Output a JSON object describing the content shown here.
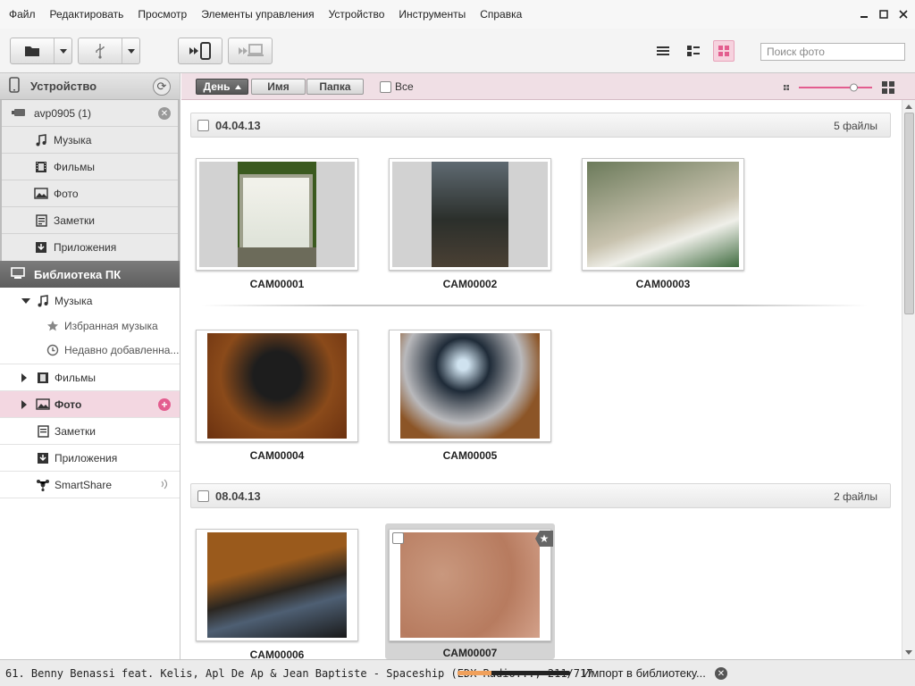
{
  "menu": [
    "Файл",
    "Редактировать",
    "Просмотр",
    "Элементы управления",
    "Устройство",
    "Инструменты",
    "Справка"
  ],
  "window_controls": [
    "minimize-icon",
    "maximize-icon",
    "close-icon"
  ],
  "search": {
    "placeholder": "Поиск фото"
  },
  "sidebar": {
    "device_header": "Устройство",
    "device_name": "avp0905 (1)",
    "device_items": [
      "Музыка",
      "Фильмы",
      "Фото",
      "Заметки",
      "Приложения"
    ],
    "library_header": "Библиотека ПК",
    "library": {
      "music": "Музыка",
      "music_children": [
        "Избранная музыка",
        "Недавно добавленна..."
      ],
      "films": "Фильмы",
      "photo": "Фото",
      "notes": "Заметки",
      "apps": "Приложения",
      "smartshare": "SmartShare"
    }
  },
  "sortbar": {
    "day": "День",
    "name": "Имя",
    "folder": "Папка",
    "all": "Все",
    "zoom_level": 0.75
  },
  "groups": [
    {
      "date": "04.04.13",
      "count": "5 файлы",
      "items": [
        "CAM00001",
        "CAM00002",
        "CAM00003",
        "CAM00004",
        "CAM00005"
      ]
    },
    {
      "date": "08.04.13",
      "count": "2 файлы",
      "items": [
        "CAM00006",
        "CAM00007"
      ]
    }
  ],
  "status": {
    "track": "61. Benny Benassi feat. Kelis, Apl De Ap & Jean Baptiste - Spaceship (EDX Radio..., 211/717",
    "progress": 0.3,
    "import": "Импорт в библиотеку..."
  },
  "colors": {
    "accent": "#e35d8f",
    "sort_bg": "#f0dfe5",
    "selected_row": "#f3d7e1",
    "progress": "#f0a05b"
  }
}
